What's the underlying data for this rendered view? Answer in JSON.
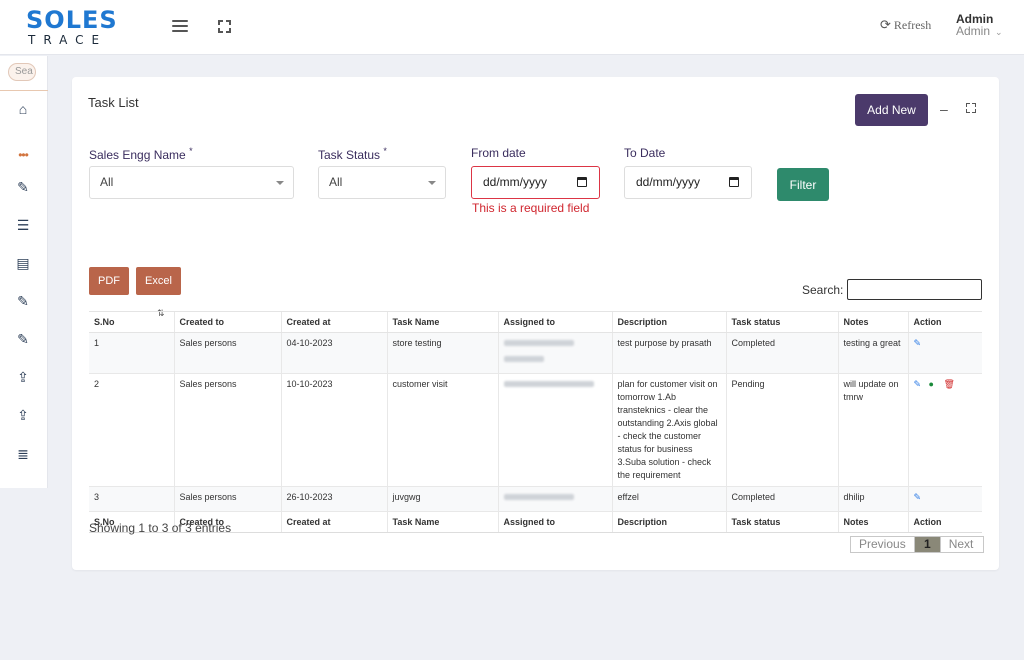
{
  "brand": {
    "line1": "SOLES",
    "line2": "TRACE",
    "color": "#1f78d1"
  },
  "header": {
    "refresh_label": "Refresh",
    "user_name": "Admin",
    "user_role": "Admin"
  },
  "sidebar": {
    "search_placeholder": "Sea",
    "items": [
      {
        "icon": "home-icon"
      },
      {
        "icon": "more-dots-icon"
      },
      {
        "icon": "edit-icon"
      },
      {
        "icon": "server-icon"
      },
      {
        "icon": "newspaper-icon"
      },
      {
        "icon": "edit-icon"
      },
      {
        "icon": "edit-icon"
      },
      {
        "icon": "upload-icon"
      },
      {
        "icon": "upload-icon"
      },
      {
        "icon": "list-icon"
      }
    ]
  },
  "card": {
    "title": "Task List",
    "add_new_label": "Add New"
  },
  "filters": {
    "sales_engg_label": "Sales Engg Name",
    "sales_engg_value": "All",
    "task_status_label": "Task Status",
    "task_status_value": "All",
    "required_mark": "*",
    "from_date_label": "From date",
    "from_date_value": "dd/mm/yyyy",
    "to_date_label": "To Date",
    "to_date_value": "dd/mm/yyyy",
    "error_text": "This is a required field",
    "filter_label": "Filter"
  },
  "export": {
    "pdf_label": "PDF",
    "excel_label": "Excel"
  },
  "search": {
    "label": "Search:"
  },
  "table": {
    "columns": [
      "S.No",
      "Created to",
      "Created at",
      "Task Name",
      "Assigned to",
      "Description",
      "Task status",
      "Notes",
      "Action"
    ],
    "rows": [
      {
        "sno": "1",
        "created_to": "Sales persons",
        "created_at": "04-10-2023",
        "task_name": "store testing",
        "description": "test purpose by prasath",
        "status": "Completed",
        "notes": "testing a great"
      },
      {
        "sno": "2",
        "created_to": "Sales persons",
        "created_at": "10-10-2023",
        "task_name": "customer visit",
        "description": "plan for customer visit on tomorrow 1.Ab transteknics - clear the outstanding 2.Axis global - check the customer status for business 3.Suba solution - check the requirement",
        "status": "Pending",
        "notes": "will update on tmrw"
      },
      {
        "sno": "3",
        "created_to": "Sales persons",
        "created_at": "26-10-2023",
        "task_name": "juvgwg",
        "description": "effzel",
        "status": "Completed",
        "notes": "dhilip"
      }
    ]
  },
  "footer": {
    "info": "Showing 1 to 3 of 3 entries",
    "prev_label": "Previous",
    "page": "1",
    "next_label": "Next"
  },
  "colors": {
    "primary_purple": "#4b3a6b",
    "filter_green": "#2e8a6c",
    "export_brown": "#b9654a",
    "error_red": "#d0262f"
  }
}
